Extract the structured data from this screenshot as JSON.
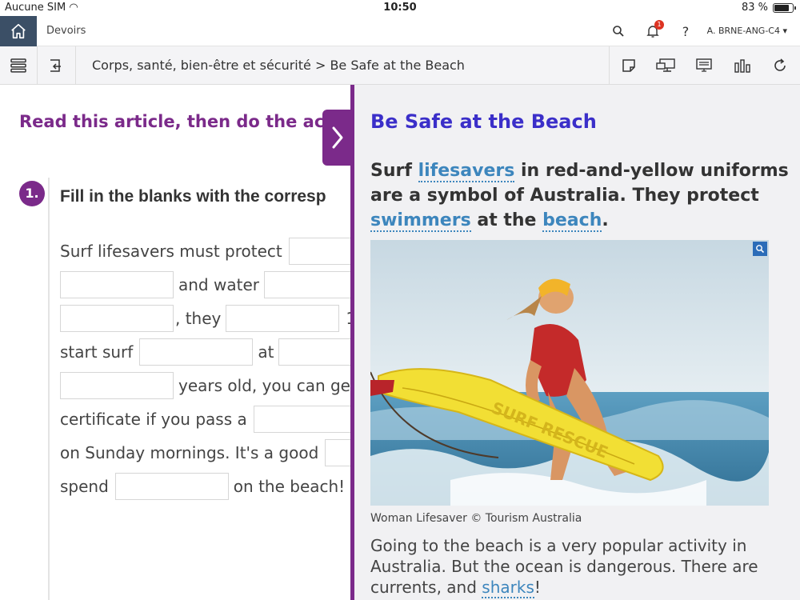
{
  "status": {
    "carrier": "Aucune SIM",
    "time": "10:50",
    "battery": "83 %",
    "battery_level": 0.83
  },
  "topbar": {
    "section": "Devoirs",
    "notification_count": "1",
    "help": "?",
    "user": "A. BRNE-ANG-C4 ▾"
  },
  "toolbar": {
    "breadcrumb": "Corps, santé, bien-être et sécurité > Be Safe at the Beach"
  },
  "left": {
    "instruction": "Read this article, then do the activi",
    "exercise_number": "1.",
    "exercise_title": "Fill in the blanks with the corresp",
    "lines": {
      "l1": "Surf lifesavers must protect",
      "l2": "and water",
      "l3": ", they",
      "l3b": "1",
      "l4a": "start surf",
      "l4b": "at",
      "l5": "years old, you can ge",
      "l6": "certificate if you pass a",
      "l7": "on Sunday mornings. It's a good",
      "l8a": "spend",
      "l8b": "on the beach!"
    }
  },
  "article": {
    "title": "Be Safe at the Beach",
    "intro": {
      "p1": "Surf ",
      "k1": "lifesavers",
      "p2": " in red-and-yellow uniforms are a symbol of Australia. They protect ",
      "k2": "swimmers",
      "p3": " at the ",
      "k3": "beach",
      "p4": "."
    },
    "caption": "Woman Lifesaver © Tourism Australia",
    "body": {
      "p1": "Going to the beach is a very popular activity in Australia. But the ocean is dangerous. There are currents, and ",
      "k1": "sharks",
      "p2": "!"
    },
    "board_text": "SURF RESCUE"
  },
  "colors": {
    "accent": "#7b2a8a",
    "title": "#3b2fc9",
    "keyword": "#3d86bd",
    "home": "#3b4f66"
  },
  "icons": [
    "home-icon",
    "search-icon",
    "bell-icon",
    "help-icon",
    "menu-icon",
    "back-icon",
    "note-icon",
    "projector-icon",
    "board-icon",
    "stats-icon",
    "refresh-icon",
    "chevron-right-icon",
    "zoom-icon"
  ]
}
